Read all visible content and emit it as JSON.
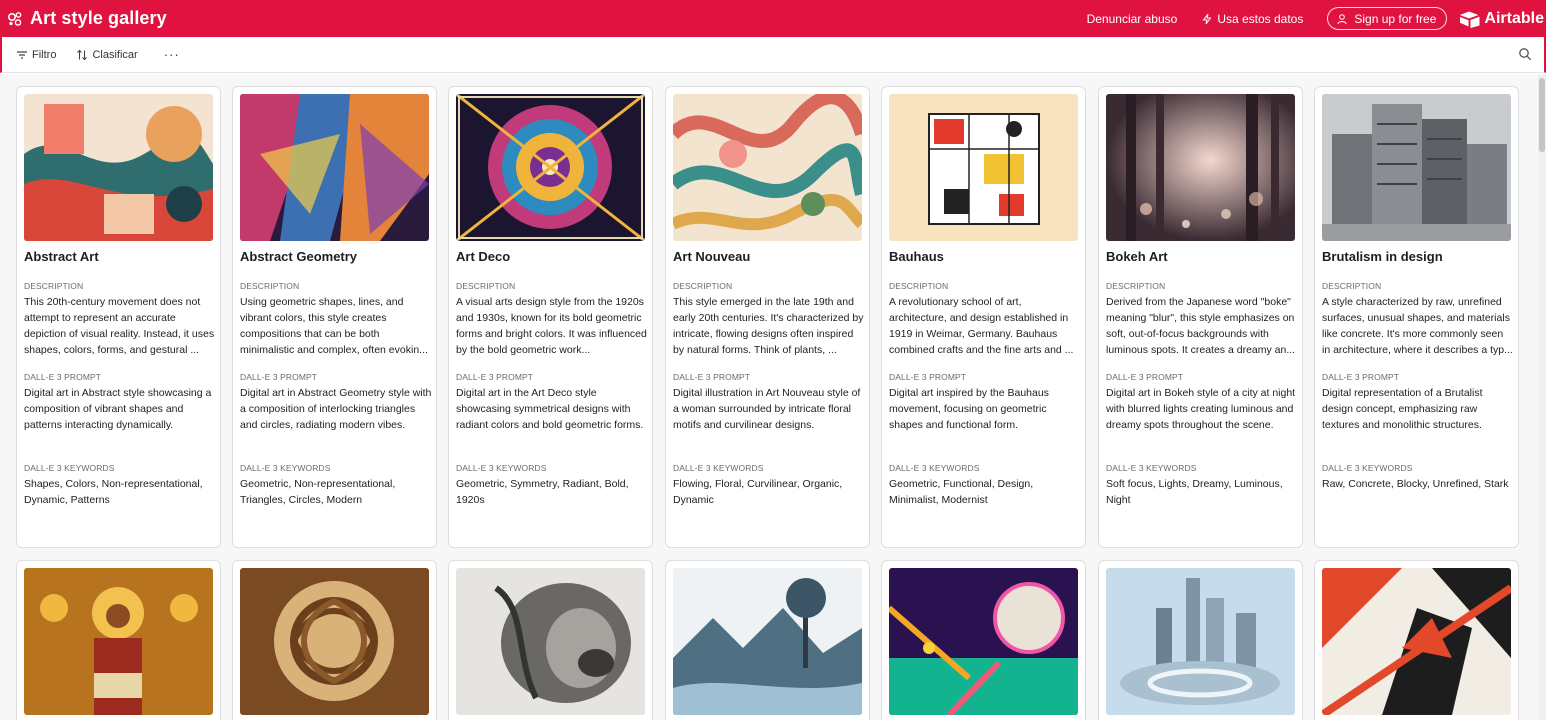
{
  "header": {
    "title": "Art style gallery",
    "report_abuse": "Denunciar abuso",
    "use_data": "Usa estos datos",
    "signup": "Sign up for free",
    "brand": "Airtable",
    "bg_color": "#e0123f"
  },
  "toolbar": {
    "filter": "Filtro",
    "sort": "Clasificar",
    "more": "···"
  },
  "fields": {
    "description": "DESCRIPTION",
    "prompt": "DALL-E 3 PROMPT",
    "keywords": "DALL-E 3 KEYWORDS"
  },
  "cards": [
    {
      "title": "Abstract Art",
      "description": "This 20th-century movement does not attempt to represent an accurate depiction of visual reality. Instead, it uses shapes, colors, forms, and gestural ...",
      "prompt": "Digital art in Abstract style showcasing a composition of vibrant shapes and patterns interacting dynamically.",
      "keywords": "Shapes, Colors, Non-representational, Dynamic, Patterns"
    },
    {
      "title": "Abstract Geometry",
      "description": "Using geometric shapes, lines, and vibrant colors, this style creates compositions that can be both minimalistic and complex, often evokin...",
      "prompt": "Digital art in Abstract Geometry style with a composition of interlocking triangles and circles, radiating modern vibes.",
      "keywords": "Geometric, Non-representational, Triangles, Circles, Modern"
    },
    {
      "title": "Art Deco",
      "description": "A visual arts design style from the 1920s and 1930s, known for its bold geometric forms and bright colors. It was influenced by the bold geometric work...",
      "prompt": "Digital art in the Art Deco style showcasing symmetrical designs with radiant colors and bold geometric forms.",
      "keywords": "Geometric, Symmetry, Radiant, Bold, 1920s"
    },
    {
      "title": "Art Nouveau",
      "description": "This style emerged in the late 19th and early 20th centuries. It's characterized by intricate, flowing designs often inspired by natural forms. Think of plants, ...",
      "prompt": "Digital illustration in Art Nouveau style of a woman surrounded by intricate floral motifs and curvilinear designs.",
      "keywords": "Flowing, Floral, Curvilinear, Organic, Dynamic"
    },
    {
      "title": "Bauhaus",
      "description": "A revolutionary school of art, architecture, and design established in 1919 in Weimar, Germany. Bauhaus combined crafts and the fine arts and ...",
      "prompt": "Digital art inspired by the Bauhaus movement, focusing on geometric shapes and functional form.",
      "keywords": "Geometric, Functional, Design, Minimalist, Modernist"
    },
    {
      "title": "Bokeh Art",
      "description": "Derived from the Japanese word \"boke\" meaning \"blur\", this style emphasizes on soft, out-of-focus backgrounds with luminous spots. It creates a dreamy an...",
      "prompt": "Digital art in Bokeh style of a city at night with blurred lights creating luminous and dreamy spots throughout the scene.",
      "keywords": "Soft focus, Lights, Dreamy, Luminous, Night"
    },
    {
      "title": "Brutalism in design",
      "description": "A style characterized by raw, unrefined surfaces, unusual shapes, and materials like concrete. It's more commonly seen in architecture, where it describes a typ...",
      "prompt": "Digital representation of a Brutalist design concept, emphasizing raw textures and monolithic structures.",
      "keywords": "Raw, Concrete, Blocky, Unrefined, Stark"
    }
  ]
}
